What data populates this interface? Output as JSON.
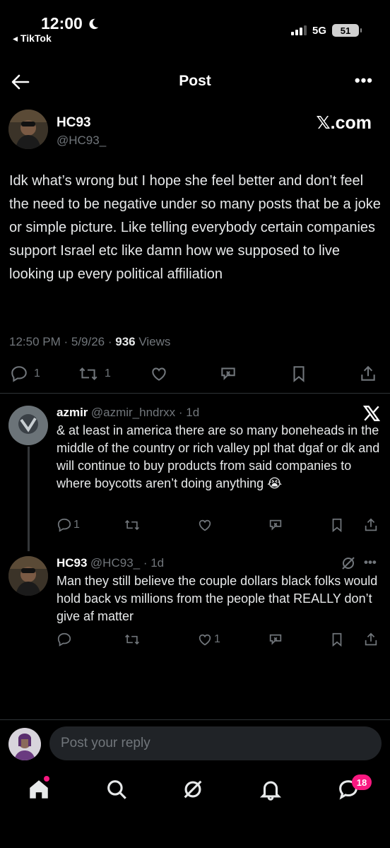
{
  "status_bar": {
    "time": "12:00",
    "back_app": "◂ TikTok",
    "network": "5G",
    "battery": "51"
  },
  "header": {
    "title": "Post"
  },
  "main_post": {
    "name": "HC93",
    "handle": "@HC93_",
    "source_label": "𝕏.com",
    "text": "Idk what’s wrong but I hope she feel better and don’t feel the need to be negative under so many posts that be a joke or simple picture. Like telling everybody certain companies support Israel etc like damn how we supposed to live looking up every political affiliation",
    "timestamp": "12:50 PM · 5/9/26 · ",
    "views_count": "936",
    "views_label": " Views",
    "reply_count": "1",
    "repost_count": "1"
  },
  "replies": [
    {
      "name": "azmir",
      "handle_time": "@azmir_hndrxx · 1d",
      "text": "& at least in america there are so many boneheads in the middle of the country or rich valley ppl that dgaf or dk and will continue to buy products from said companies to where boycotts aren’t doing anything 😭",
      "reply_count": "1"
    },
    {
      "name": "HC93",
      "handle_time": "@HC93_ · 1d",
      "text": "Man they still believe the couple dollars black folks would hold back vs millions from the people that REALLY don’t give af  matter",
      "like_count": "1"
    }
  ],
  "composer": {
    "placeholder": "Post your reply"
  },
  "tabs": {
    "messages_badge": "18"
  },
  "colors": {
    "background": "#000000",
    "text": "#e7e9ea",
    "muted": "#71767b",
    "accent": "#f91880"
  }
}
